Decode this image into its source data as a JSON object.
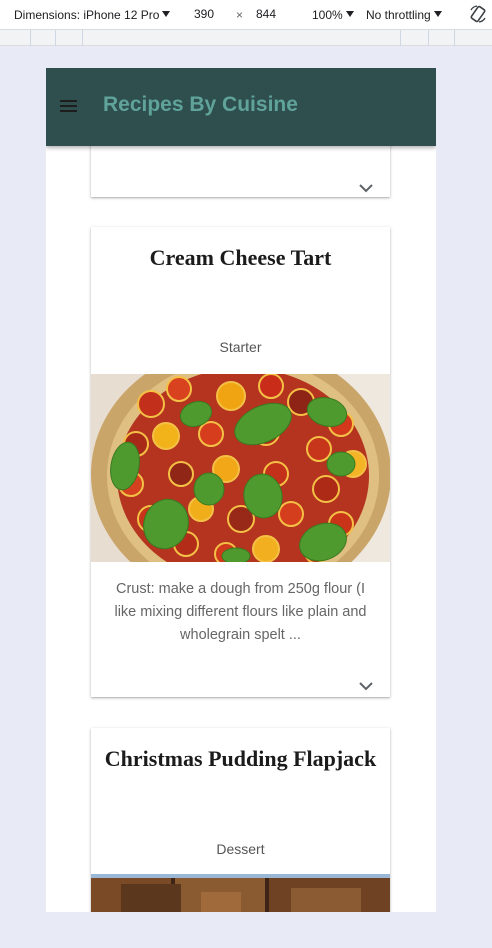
{
  "devtools": {
    "dimensions_label": "Dimensions: iPhone 12 Pro",
    "width_value": "390",
    "times_sign": "×",
    "height_value": "844",
    "zoom_label": "100%",
    "throttle_label": "No throttling"
  },
  "app": {
    "title": "Recipes By Cuisine",
    "header_color": "#2f4f4f",
    "title_color": "#5fa39a"
  },
  "recipes": [
    {
      "title": "Cream Cheese Tart",
      "category": "Starter",
      "description": "Crust: make a dough from 250g flour (I like mixing different flours like plain and wholegrain spelt ..."
    },
    {
      "title": "Christmas Pudding Flapjack",
      "category": "Dessert"
    }
  ],
  "icons": {
    "menu": "menu-icon",
    "expand": "chevron-down-icon",
    "rotate": "rotate-icon"
  }
}
